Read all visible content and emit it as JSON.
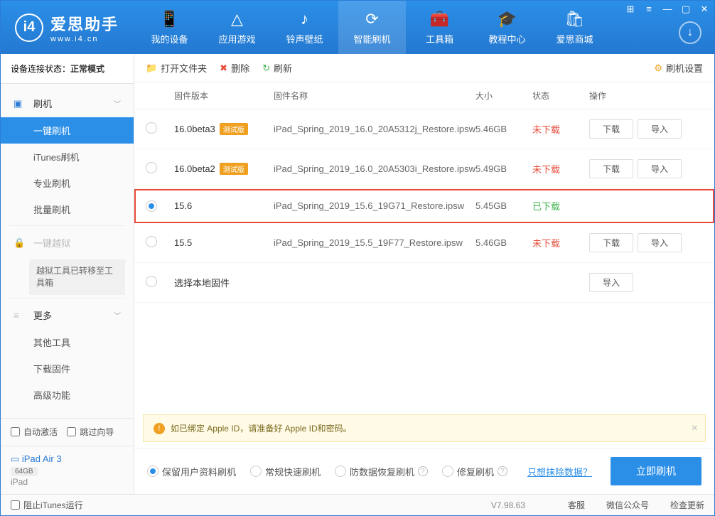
{
  "logo": {
    "title": "爱思助手",
    "sub": "www.i4.cn"
  },
  "nav": [
    {
      "icon": "📱",
      "label": "我的设备"
    },
    {
      "icon": "△",
      "label": "应用游戏"
    },
    {
      "icon": "♪",
      "label": "铃声壁纸"
    },
    {
      "icon": "⟳",
      "label": "智能刷机",
      "active": true
    },
    {
      "icon": "🧰",
      "label": "工具箱"
    },
    {
      "icon": "🎓",
      "label": "教程中心"
    },
    {
      "icon": "🛍",
      "label": "爱思商城"
    }
  ],
  "status": {
    "label": "设备连接状态：",
    "value": "正常模式"
  },
  "sidebar": {
    "flash": {
      "title": "刷机",
      "items": [
        "一键刷机",
        "iTunes刷机",
        "专业刷机",
        "批量刷机"
      ]
    },
    "jailbreak": {
      "title": "一键越狱",
      "note": "越狱工具已转移至工具箱"
    },
    "more": {
      "title": "更多",
      "items": [
        "其他工具",
        "下载固件",
        "高级功能"
      ]
    },
    "auto": "自动激活",
    "skip": "跳过向导",
    "device": {
      "name": "iPad Air 3",
      "cap": "64GB",
      "type": "iPad"
    }
  },
  "toolbar": {
    "open": "打开文件夹",
    "del": "删除",
    "refresh": "刷新",
    "settings": "刷机设置"
  },
  "table": {
    "headers": {
      "ver": "固件版本",
      "name": "固件名称",
      "size": "大小",
      "status": "状态",
      "act": "操作"
    },
    "rows": [
      {
        "ver": "16.0beta3",
        "badge": "测试版",
        "name": "iPad_Spring_2019_16.0_20A5312j_Restore.ipsw",
        "size": "5.46GB",
        "status": "未下载",
        "downloaded": false,
        "selected": false,
        "actions": true
      },
      {
        "ver": "16.0beta2",
        "badge": "测试版",
        "name": "iPad_Spring_2019_16.0_20A5303i_Restore.ipsw",
        "size": "5.49GB",
        "status": "未下载",
        "downloaded": false,
        "selected": false,
        "actions": true
      },
      {
        "ver": "15.6",
        "badge": "",
        "name": "iPad_Spring_2019_15.6_19G71_Restore.ipsw",
        "size": "5.45GB",
        "status": "已下载",
        "downloaded": true,
        "selected": true,
        "actions": false
      },
      {
        "ver": "15.5",
        "badge": "",
        "name": "iPad_Spring_2019_15.5_19F77_Restore.ipsw",
        "size": "5.46GB",
        "status": "未下载",
        "downloaded": false,
        "selected": false,
        "actions": true
      }
    ],
    "localRow": "选择本地固件",
    "btnDownload": "下载",
    "btnImport": "导入"
  },
  "alert": "如已绑定 Apple ID，请准备好 Apple ID和密码。",
  "options": {
    "o1": "保留用户资料刷机",
    "o2": "常规快速刷机",
    "o3": "防数据恢复刷机",
    "o4": "修复刷机",
    "link": "只想抹除数据？",
    "primary": "立即刷机"
  },
  "footer": {
    "block": "阻止iTunes运行",
    "version": "V7.98.63",
    "l1": "客服",
    "l2": "微信公众号",
    "l3": "检查更新"
  }
}
